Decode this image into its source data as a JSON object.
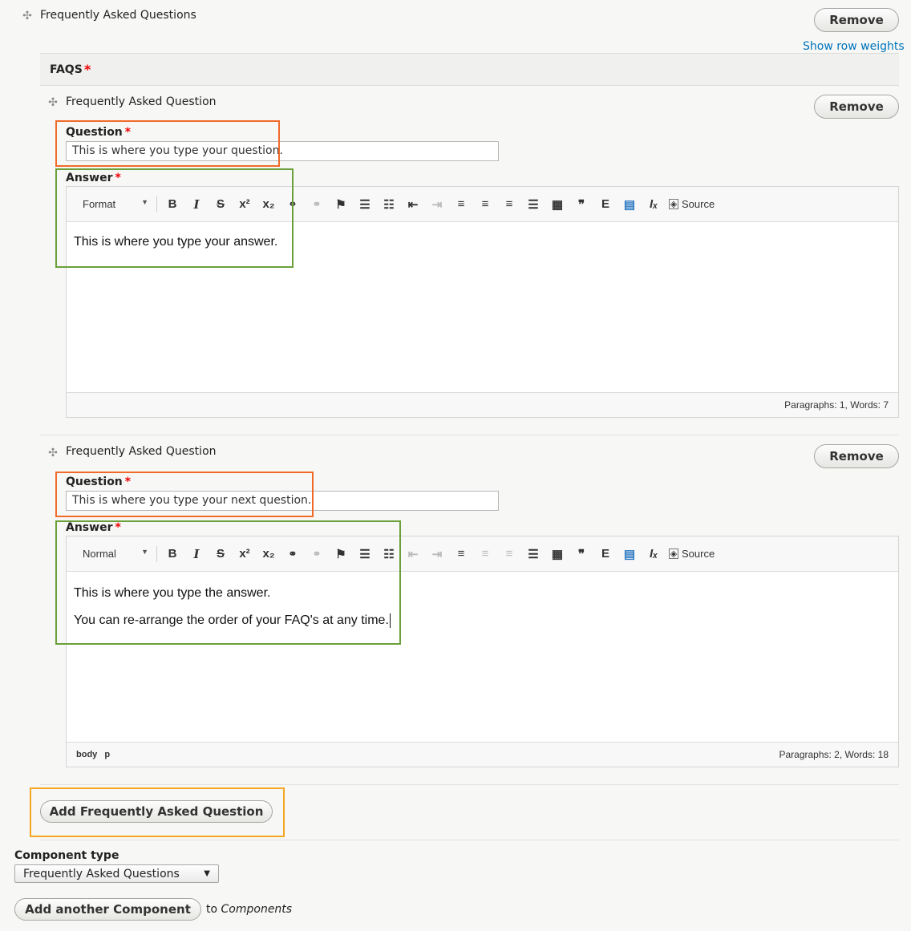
{
  "section": {
    "title": "Frequently Asked Questions",
    "remove_label": "Remove",
    "show_row_weights": "Show row weights"
  },
  "faqs_header": {
    "label": "FAQS",
    "required_mark": "*"
  },
  "items": [
    {
      "title": "Frequently Asked Question",
      "remove_label": "Remove",
      "question_label": "Question",
      "question_value": "This is where you type your question.",
      "answer_label": "Answer",
      "format": "Format",
      "paragraphs": [
        "This is where you type your answer."
      ],
      "status_left": "",
      "status_right": "Paragraphs: 1, Words: 7"
    },
    {
      "title": "Frequently Asked Question",
      "remove_label": "Remove",
      "question_label": "Question",
      "question_value": "This is where you type your next question.",
      "answer_label": "Answer",
      "format": "Normal",
      "paragraphs": [
        "This is where you type the answer.",
        "You can re-arrange the order of your FAQ's at any time."
      ],
      "status_left": "body  p",
      "status_right": "Paragraphs: 2, Words: 18"
    }
  ],
  "toolbar": {
    "source_label": "Source"
  },
  "add_faq_button": "Add Frequently Asked Question",
  "component": {
    "label": "Component type",
    "selected": "Frequently Asked Questions",
    "add_button": "Add another Component",
    "to_text": "to",
    "to_target": "Components"
  },
  "icons": {
    "drag": "drag-handle-icon",
    "dropdown": "caret-down-icon"
  },
  "colors": {
    "link": "#0074bd",
    "required": "#e00000",
    "highlight_question": "#f06b2a",
    "highlight_answer": "#6aa03a",
    "highlight_add": "#f5a623"
  }
}
